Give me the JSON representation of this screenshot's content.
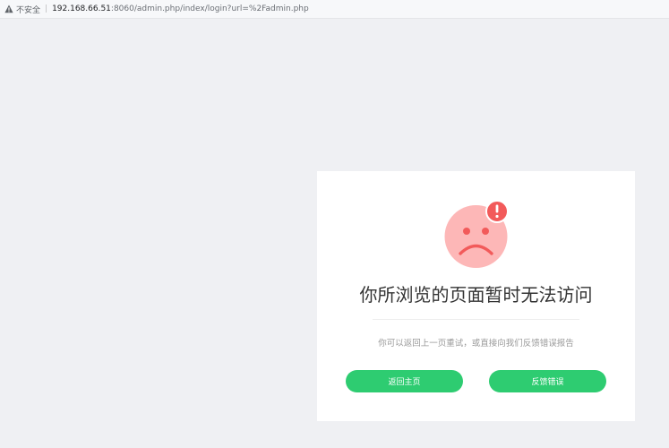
{
  "address_bar": {
    "insecure_label": "不安全",
    "separator": "|",
    "url_host": "192.168.66.51",
    "url_rest": ":8060/admin.php/index/login?url=%2Fadmin.php",
    "warn_icon": "warning-triangle-icon"
  },
  "error_page": {
    "icon": "sad-face-with-alert-icon",
    "title": "你所浏览的页面暂时无法访问",
    "subtitle": "你可以返回上一页重试，或直接向我们反馈错误报告",
    "buttons": {
      "home_label": "返回主页",
      "report_label": "反馈错误"
    }
  },
  "colors": {
    "page_background": "#eff0f3",
    "card_background": "#ffffff",
    "button_green": "#2ecc71",
    "face_pink": "#fdb7b7",
    "alert_red": "#f25a5a"
  }
}
